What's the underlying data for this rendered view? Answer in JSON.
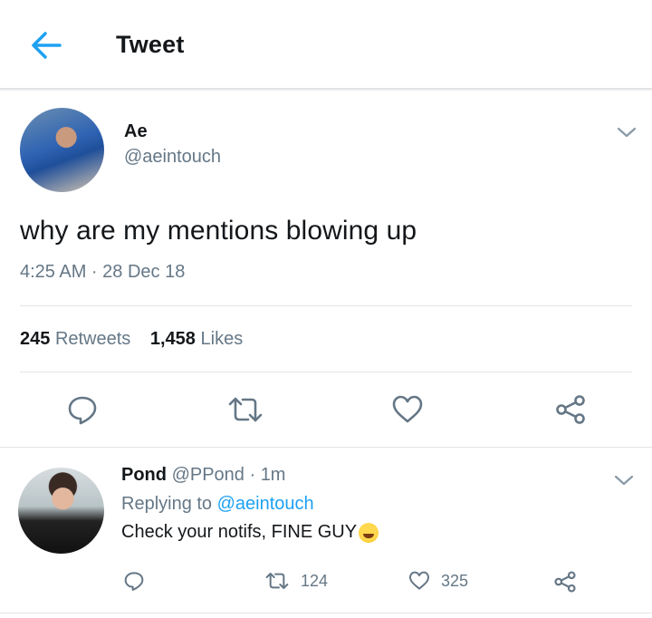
{
  "header": {
    "title": "Tweet"
  },
  "tweet": {
    "author_name": "Ae",
    "author_handle": "@aeintouch",
    "text": "why are my mentions blowing up",
    "timestamp": "4:25 AM · 28 Dec 18",
    "retweets_count": "245",
    "retweets_label": "Retweets",
    "likes_count": "1,458",
    "likes_label": "Likes"
  },
  "reply": {
    "author_name": "Pond",
    "author_meta": "@PPond · 1m",
    "replying_prefix": "Replying to",
    "replying_to": "@aeintouch",
    "text": "Check your notifs, FINE GUY",
    "emoji": "grinning-squinting-face-emoji",
    "retweets": "124",
    "likes": "325"
  },
  "icons": {
    "back": "arrow-left-icon",
    "menu": "chevron-down-icon",
    "reply": "reply-bubble-icon",
    "retweet": "retweet-icon",
    "like": "heart-icon",
    "share": "share-icon"
  },
  "colors": {
    "accent": "#1da1f2",
    "secondary_text": "#657786",
    "icon": "#657786",
    "divider": "#e1e4e6"
  }
}
